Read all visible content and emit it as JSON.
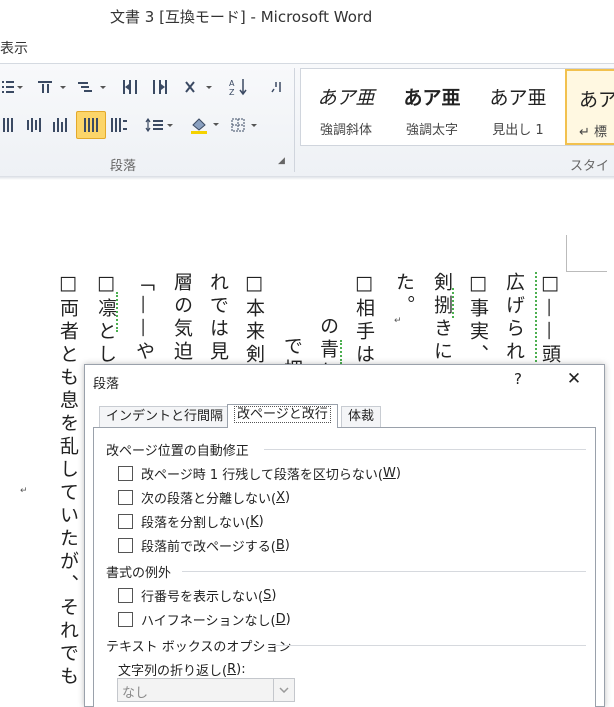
{
  "window": {
    "title": "文書 3 [互換モード] - Microsoft Word"
  },
  "menu": {
    "view_label": "表示"
  },
  "ribbon": {
    "paragraph_group_label": "段落",
    "styles_group_label": "スタイル",
    "styles": [
      {
        "sample": "あア亜",
        "name": "強調斜体"
      },
      {
        "sample": "あア亜",
        "name": "強調太字"
      },
      {
        "sample": "あア亜",
        "name": "見出し 1"
      },
      {
        "sample": "あア",
        "name": "↵ 標"
      }
    ],
    "colors": {
      "accent_selected": "#fcd569",
      "highlight_yellow": "#f5d200"
    }
  },
  "document": {
    "columns": [
      "□——頭",
      "広げられ",
      "□事実、周",
      "剣捌きに霊",
      "た。",
      "□相手は",
      "の青年",
      "で押",
      "□本来剣に",
      "れでは見抜",
      "層の気迫を",
      "「——や",
      "□凛とし",
      "□両者とも息を乱していたが、それでも"
    ],
    "paragraph_mark": "↵"
  },
  "dialog": {
    "title": "段落",
    "help": "?",
    "close": "✕",
    "tabs": [
      {
        "label": "インデントと行間隔"
      },
      {
        "label": "改ページと改行"
      },
      {
        "label": "体裁"
      }
    ],
    "sections": {
      "pagination": "改ページ位置の自動修正",
      "formatting_exceptions": "書式の例外",
      "textbox_options": "テキスト ボックスのオプション"
    },
    "checkboxes": {
      "widow_pre": "改ページ時 1 行残して段落を区切らない(",
      "widow_key": "W",
      "keep_next_pre": "次の段落と分離しない(",
      "keep_next_key": "X",
      "keep_lines_pre": "段落を分割しない(",
      "keep_lines_key": "K",
      "page_break_pre": "段落前で改ページする(",
      "page_break_key": "B",
      "suppress_ln_pre": "行番号を表示しない(",
      "suppress_ln_key": "S",
      "no_hyph_pre": "ハイフネーションなし(",
      "no_hyph_key": "D",
      "close_paren": ")"
    },
    "wrap": {
      "label_pre": "文字列の折り返し(",
      "label_key": "R",
      "label_post": "):",
      "value": "なし"
    }
  }
}
